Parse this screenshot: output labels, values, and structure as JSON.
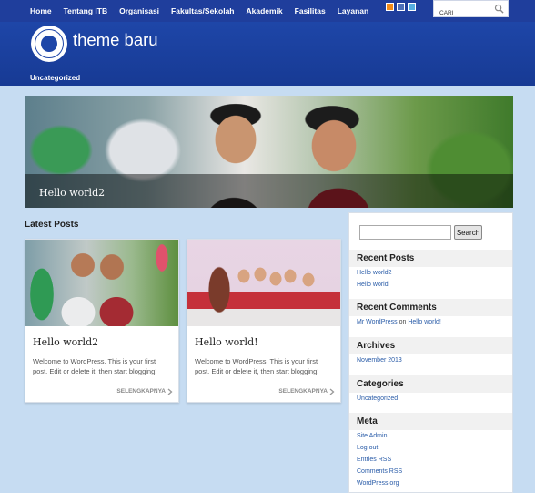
{
  "nav": {
    "items": [
      "Home",
      "Tentang ITB",
      "Organisasi",
      "Fakultas/Sekolah",
      "Akademik",
      "Fasilitas",
      "Layanan"
    ]
  },
  "social_icons": [
    "rss-icon",
    "facebook-icon",
    "twitter-icon"
  ],
  "top_search": {
    "value": "CARI"
  },
  "header": {
    "site_title": "theme baru",
    "category_link": "Uncategorized"
  },
  "hero": {
    "title": "Hello world2"
  },
  "latest": {
    "heading": "Latest Posts",
    "posts": [
      {
        "title": "Hello world2",
        "excerpt": "Welcome to WordPress. This is your first post. Edit or delete it, then start blogging!",
        "more": "SELENGKAPNYA"
      },
      {
        "title": "Hello world!",
        "excerpt": "Welcome to WordPress. This is your first post. Edit or delete it, then start blogging!",
        "more": "SELENGKAPNYA"
      }
    ]
  },
  "sidebar": {
    "search_button": "Search",
    "recent_posts": {
      "heading": "Recent Posts",
      "items": [
        "Hello world2",
        "Hello world!"
      ]
    },
    "recent_comments": {
      "heading": "Recent Comments",
      "author": "Mr WordPress",
      "on": "on",
      "post": "Hello world!"
    },
    "archives": {
      "heading": "Archives",
      "items": [
        "November 2013"
      ]
    },
    "categories": {
      "heading": "Categories",
      "items": [
        "Uncategorized"
      ]
    },
    "meta": {
      "heading": "Meta",
      "items": [
        "Site Admin",
        "Log out",
        "Entries RSS",
        "Comments RSS",
        "WordPress.org"
      ]
    }
  },
  "colors": {
    "nav_bg": "#1f3e9c",
    "header_bg": "#1b3d9c",
    "page_bg": "#c6dcf2",
    "link": "#2a5ca8"
  }
}
